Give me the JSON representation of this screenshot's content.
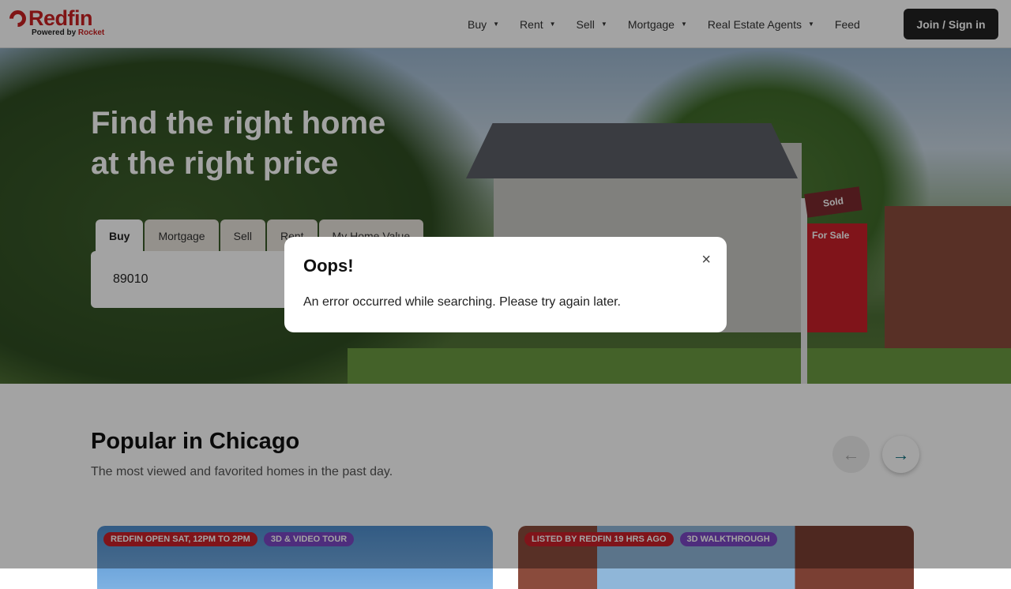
{
  "header": {
    "logo": {
      "brand": "Redfin",
      "powered": "Powered by",
      "partner": "Rocket"
    },
    "nav": [
      {
        "label": "Buy",
        "dropdown": true
      },
      {
        "label": "Rent",
        "dropdown": true
      },
      {
        "label": "Sell",
        "dropdown": true
      },
      {
        "label": "Mortgage",
        "dropdown": true
      },
      {
        "label": "Real Estate Agents",
        "dropdown": true
      },
      {
        "label": "Feed",
        "dropdown": false
      }
    ],
    "join_label": "Join / Sign in"
  },
  "hero": {
    "title_line1": "Find the right home",
    "title_line2": "at the right price",
    "tabs": [
      "Buy",
      "Mortgage",
      "Sell",
      "Rent",
      "My Home Value"
    ],
    "active_tab": "Buy",
    "search_value": "89010",
    "sign_text": "For Sale",
    "sign_top": "Sold"
  },
  "popular": {
    "title": "Popular in Chicago",
    "subtitle": "The most viewed and favorited homes in the past day.",
    "cards": [
      {
        "badges": [
          "REDFIN OPEN SAT, 12PM TO 2PM",
          "3D & VIDEO TOUR"
        ]
      },
      {
        "badges": [
          "LISTED BY REDFIN 19 HRS AGO",
          "3D WALKTHROUGH"
        ]
      }
    ]
  },
  "modal": {
    "title": "Oops!",
    "message": "An error occurred while searching. Please try again later.",
    "close": "×"
  },
  "colors": {
    "brand": "#c82021",
    "badge_red": "#c8202a",
    "badge_purple": "#7b47c4",
    "accent": "#0c6e7d"
  }
}
